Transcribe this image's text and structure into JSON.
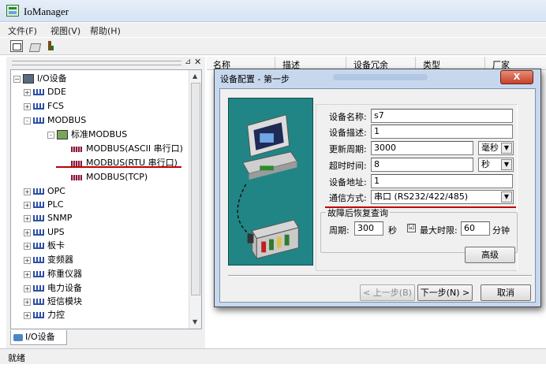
{
  "app": {
    "title": "IoManager"
  },
  "menu": {
    "file": "文件(F)",
    "view": "视图(V)",
    "help": "帮助(H)"
  },
  "tree": {
    "root": "I/O设备",
    "items": [
      {
        "label": "DDE",
        "expander": "+"
      },
      {
        "label": "FCS",
        "expander": "+"
      },
      {
        "label": "MODBUS",
        "expander": "-"
      },
      {
        "label": "标准MODBUS",
        "expander": "-"
      },
      {
        "label": "MODBUS(ASCII 串行口)"
      },
      {
        "label": "MODBUS(RTU 串行口)"
      },
      {
        "label": "MODBUS(TCP)"
      },
      {
        "label": "OPC",
        "expander": "+"
      },
      {
        "label": "PLC",
        "expander": "+"
      },
      {
        "label": "SNMP",
        "expander": "+"
      },
      {
        "label": "UPS",
        "expander": "+"
      },
      {
        "label": "板卡",
        "expander": "+"
      },
      {
        "label": "变频器",
        "expander": "+"
      },
      {
        "label": "称重仪器",
        "expander": "+"
      },
      {
        "label": "电力设备",
        "expander": "+"
      },
      {
        "label": "短信模块",
        "expander": "+"
      },
      {
        "label": "力控",
        "expander": "+"
      }
    ],
    "bottom_tab": "I/O设备"
  },
  "list": {
    "columns": [
      "名称",
      "描述",
      "设备冗余",
      "类型",
      "厂家"
    ]
  },
  "status": {
    "text": "就绪"
  },
  "dialog": {
    "title": "设备配置 - 第一步",
    "close": "X",
    "labels": {
      "name": "设备名称:",
      "desc": "设备描述:",
      "period": "更新周期:",
      "timeout": "超时时间:",
      "address": "设备地址:",
      "comm": "通信方式:",
      "recovery_group": "故障后恢复查询",
      "cycle": "周期:",
      "seconds": "秒",
      "maxlimit": "最大时限:",
      "minutes": "分钟"
    },
    "values": {
      "name": "s7",
      "desc": "1",
      "period": "3000",
      "period_unit": "毫秒",
      "timeout": "8",
      "timeout_unit": "秒",
      "address": "1",
      "comm": "串口 (RS232/422/485)",
      "cycle": "300",
      "maxlimit": "60",
      "maxlimit_checked": "☑"
    },
    "buttons": {
      "advanced": "高级",
      "prev": "< 上一步(B)",
      "next": "下一步(N) >",
      "cancel": "取消"
    }
  }
}
